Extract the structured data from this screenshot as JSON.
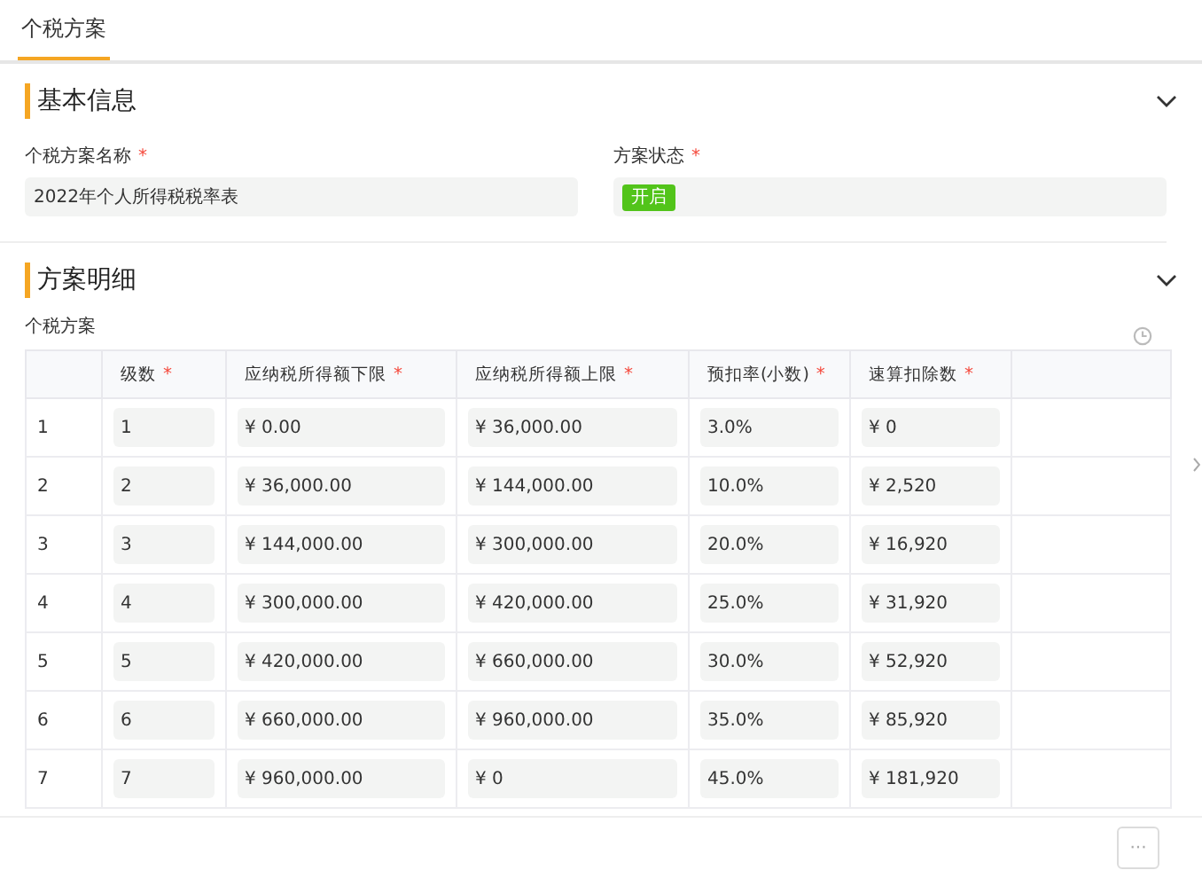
{
  "tabs": [
    {
      "label": "个税方案",
      "selected": true
    }
  ],
  "sections": [
    {
      "title": "基本信息",
      "expanded": true
    },
    {
      "title": "方案明细",
      "expanded": true
    }
  ],
  "basic_fields": [
    {
      "label": "个税方案名称",
      "mark": "*",
      "value": "2022年个人所得税税率表",
      "kind": "text"
    },
    {
      "label": "方案状态",
      "mark": "*",
      "value": "开启",
      "kind": "tag",
      "color": "#52c41a"
    }
  ],
  "table": {
    "title": "个税方案",
    "columns": [
      {
        "label": "级数",
        "mark": "*"
      },
      {
        "label": "应纳税所得额下限",
        "mark": "*"
      },
      {
        "label": "应纳税所得额上限",
        "mark": "*"
      },
      {
        "label": "预扣率(小数)",
        "mark": "*"
      },
      {
        "label": "速算扣除数",
        "mark": "*"
      }
    ],
    "rows": [
      {
        "index": "1",
        "cells": [
          "1",
          "¥ 0.00",
          "¥ 36,000.00",
          "3.0%",
          "¥ 0"
        ]
      },
      {
        "index": "2",
        "cells": [
          "2",
          "¥ 36,000.00",
          "¥ 144,000.00",
          "10.0%",
          "¥ 2,520"
        ]
      },
      {
        "index": "3",
        "cells": [
          "3",
          "¥ 144,000.00",
          "¥ 300,000.00",
          "20.0%",
          "¥ 16,920"
        ]
      },
      {
        "index": "4",
        "cells": [
          "4",
          "¥ 300,000.00",
          "¥ 420,000.00",
          "25.0%",
          "¥ 31,920"
        ]
      },
      {
        "index": "5",
        "cells": [
          "5",
          "¥ 420,000.00",
          "¥ 660,000.00",
          "30.0%",
          "¥ 52,920"
        ]
      },
      {
        "index": "6",
        "cells": [
          "6",
          "¥ 660,000.00",
          "¥ 960,000.00",
          "35.0%",
          "¥ 85,920"
        ]
      },
      {
        "index": "7",
        "cells": [
          "7",
          "¥ 960,000.00",
          "¥ 0",
          "45.0%",
          "¥ 181,920"
        ]
      }
    ]
  },
  "footer": {
    "more_button": "···"
  }
}
